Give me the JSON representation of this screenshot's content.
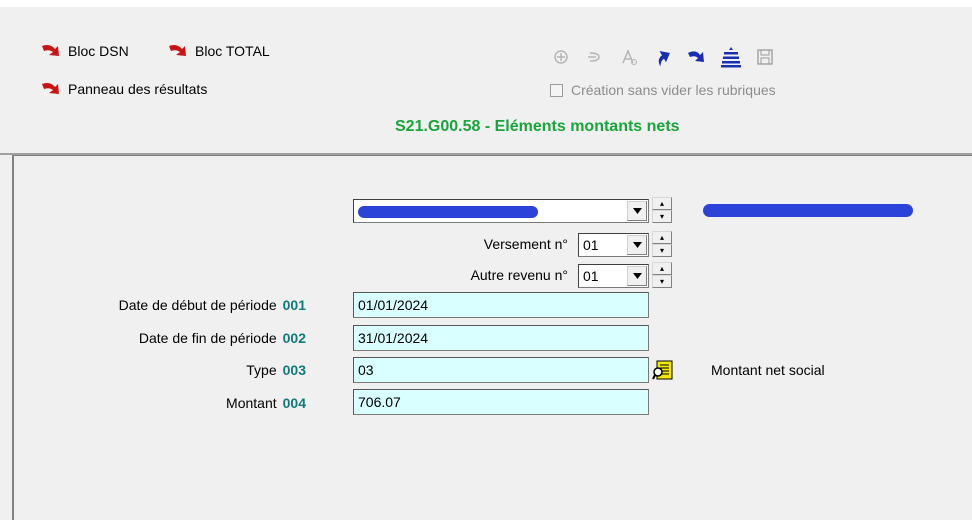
{
  "nav": {
    "bloc_dsn": "Bloc DSN",
    "bloc_total": "Bloc TOTAL",
    "panneau": "Panneau des résultats"
  },
  "toolbar": {
    "icons": [
      "add-icon",
      "remove-icon",
      "font-icon",
      "arrow-up-icon",
      "arrow-down-icon",
      "list-icon",
      "save-icon"
    ],
    "checkbox_label": "Création sans vider les rubriques",
    "checkbox_checked": false
  },
  "section_title": "S21.G00.58 - Eléments montants nets",
  "selectors": {
    "person_value": "",
    "versement_label": "Versement n°",
    "versement_value": "01",
    "autre_revenu_label": "Autre revenu n°",
    "autre_revenu_value": "01"
  },
  "fields": [
    {
      "label": "Date de début de période",
      "code": "001",
      "value": "01/01/2024"
    },
    {
      "label": "Date de fin de période",
      "code": "002",
      "value": "31/01/2024"
    },
    {
      "label": "Type",
      "code": "003",
      "value": "03"
    },
    {
      "label": "Montant",
      "code": "004",
      "value": "706.07"
    }
  ],
  "type_description": "Montant net social",
  "colors": {
    "title_green": "#18a53a",
    "code_teal": "#117a7a",
    "field_bg": "#d9ffff",
    "arrow_red": "#c81414",
    "arrow_blue": "#1a2fb0"
  }
}
